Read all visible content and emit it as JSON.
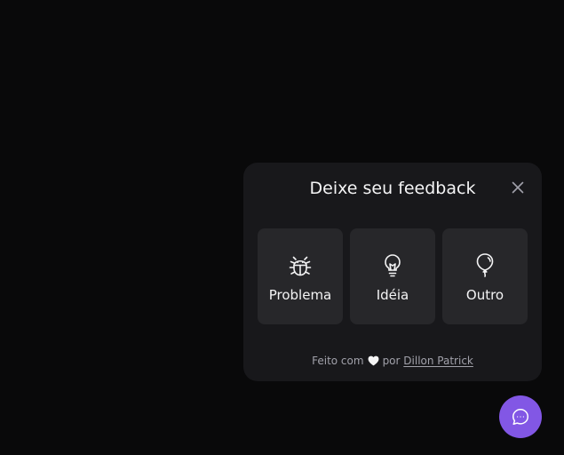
{
  "widget": {
    "title": "Deixe seu feedback",
    "close_icon": "close-icon",
    "options": [
      {
        "label": "Problema",
        "icon": "bug-icon"
      },
      {
        "label": "Idéia",
        "icon": "lightbulb-icon"
      },
      {
        "label": "Outro",
        "icon": "balloon-icon"
      }
    ],
    "footer": {
      "made_with": "Feito com",
      "heart_icon": "heart-icon",
      "by": "por",
      "author": "Dillon Patrick"
    }
  },
  "fab": {
    "icon": "chat-icon"
  },
  "colors": {
    "background": "#09090a",
    "card": "#18181b",
    "option": "#27272a",
    "text": "#f4f4f5",
    "muted": "#a1a1aa",
    "accent": "#8257e5"
  }
}
